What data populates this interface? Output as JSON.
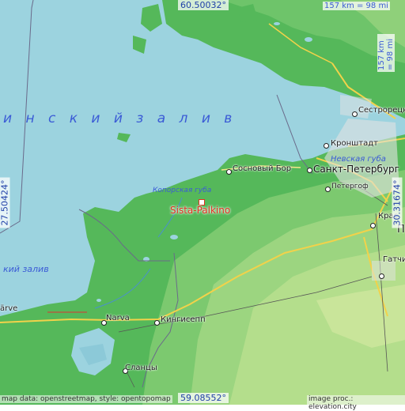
{
  "place": {
    "name": "Sista-Palkino"
  },
  "coordinates": {
    "north": "60.50032°",
    "south": "59.08552°",
    "west": "27.50424°",
    "east": "30.31674°"
  },
  "scale": {
    "top": "157 km = 98 mi",
    "right": "157 km = 98 mi"
  },
  "attribution": {
    "left": "map data: openstreetmap, style: opentopomap",
    "right": "image proc.: elevation.city"
  },
  "water_labels": {
    "gulf_upper": "и н с к и й   з а л и в",
    "gulf_left": "кий залив",
    "koporye_bay": "Копорская губа",
    "neva_bay": "Невская губа"
  },
  "cities": {
    "sosnovy_bor": "Сосновый Бор",
    "kronstadt": "Кронштадт",
    "saint_petersburg": "Санкт-Петербург",
    "petergof": "Петергоф",
    "sestroretsk": "Сестрорецк",
    "narva": "Narva",
    "kingisepp": "Кингисепп",
    "slantsy": "Сланцы",
    "gatchina": "Гатчи",
    "krasnoe": "Крас",
    "varve": "ärve",
    "pu": "П"
  },
  "colors": {
    "water": "#9cd3df",
    "lowland": "#55b85a",
    "upland": "#8fd07a",
    "highland": "#c9e59a",
    "road": "#f2d24a",
    "marker": "#e03020"
  }
}
